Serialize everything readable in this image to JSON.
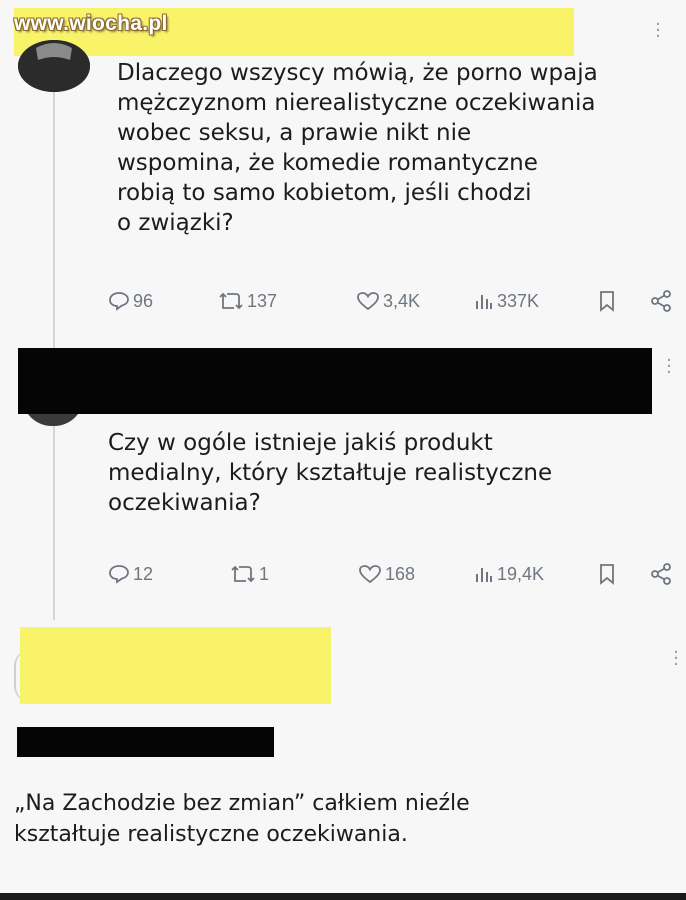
{
  "watermark": "www.wiocha.pl",
  "tweets": [
    {
      "text": "Dlaczego wszyscy mówią, że porno wpaja\nmężczyznom nierealistyczne oczekiwania\nwobec seksu, a prawie nikt nie\nwspomina, że komedie romantyczne\nrobią to samo kobietom, jeśli chodzi\no związki?",
      "replies": "96",
      "retweets": "137",
      "likes": "3,4K",
      "views": "337K"
    },
    {
      "text": "Czy w ogóle istnieje jakiś produkt\nmedialny, który kształtuje realistyczne\noczekiwania?",
      "replies": "12",
      "retweets": "1",
      "likes": "168",
      "views": "19,4K"
    }
  ],
  "reply_text": "„Na Zachodzie bez zmian” całkiem nieźle\nkształtuje realistyczne oczekiwania.",
  "colors": {
    "redaction_yellow": "#f9f36a",
    "redaction_black": "#050505",
    "icon_gray": "#6e7680"
  }
}
